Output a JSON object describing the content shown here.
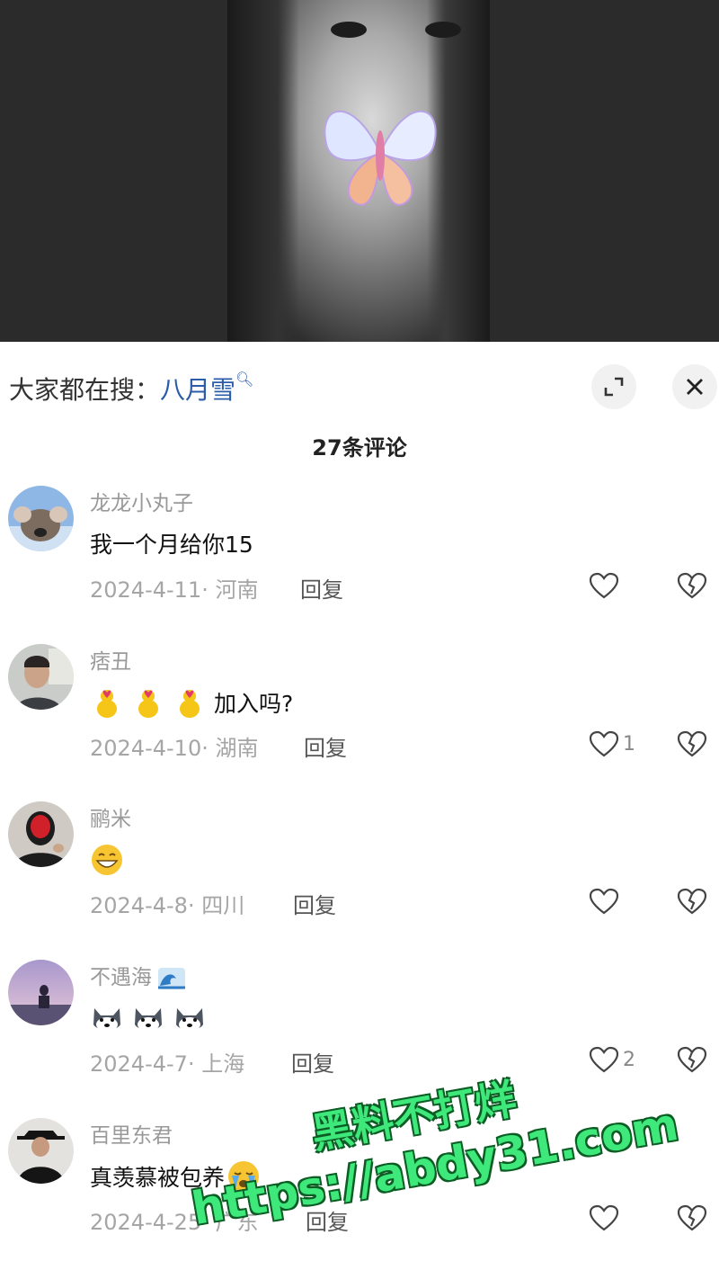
{
  "search_hint": {
    "prefix": "大家都在搜：",
    "keyword": "八月雪"
  },
  "comment_count": "27条评论",
  "comments": [
    {
      "username": "龙龙小丸子",
      "text": "我一个月给你15",
      "date": "2024-4-11",
      "location": "河南",
      "reply": "回复",
      "likes": ""
    },
    {
      "username": "痞丑",
      "text": "加入吗?",
      "date": "2024-4-10",
      "location": "湖南",
      "reply": "回复",
      "likes": "1"
    },
    {
      "username": "鹂米",
      "text": "",
      "date": "2024-4-8",
      "location": "四川",
      "reply": "回复",
      "likes": ""
    },
    {
      "username": "不遇海",
      "text": "",
      "date": "2024-4-7",
      "location": "上海",
      "reply": "回复",
      "likes": "2"
    },
    {
      "username": "百里东君",
      "text": "真羡慕被包养",
      "date": "2024-4-25",
      "location": "广东",
      "reply": "回复",
      "likes": ""
    }
  ],
  "watermark": {
    "line1": "黑料不打烊",
    "line2": "https://abdy31.com"
  },
  "colors": {
    "keyword": "#2a5caa",
    "watermark": "#3ee87a",
    "meta": "#a5a5a5"
  }
}
